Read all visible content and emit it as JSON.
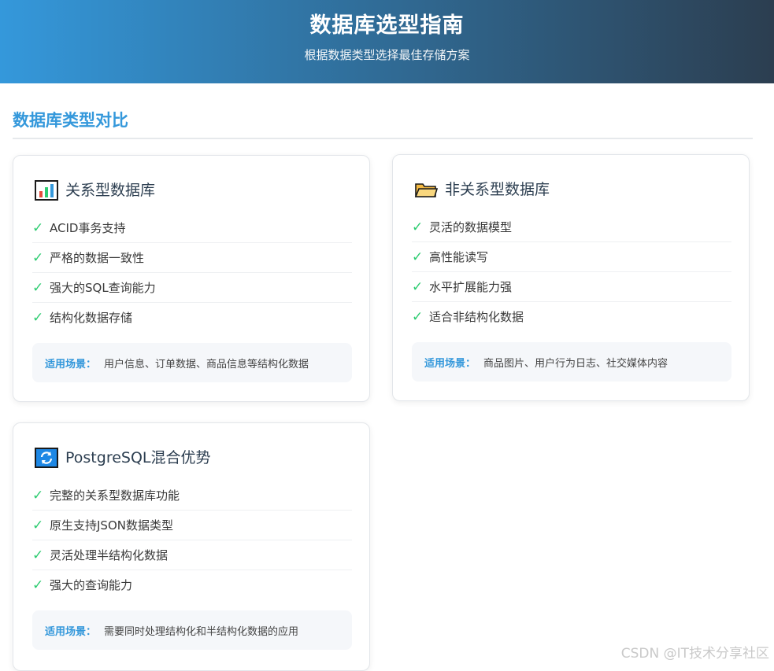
{
  "header": {
    "title": "数据库选型指南",
    "subtitle": "根据数据类型选择最佳存储方案"
  },
  "section": {
    "title": "数据库类型对比"
  },
  "cards": [
    {
      "icon": "bar-chart-icon",
      "title": "关系型数据库",
      "features": [
        "ACID事务支持",
        "严格的数据一致性",
        "强大的SQL查询能力",
        "结构化数据存储"
      ],
      "scenario_label": "适用场景：",
      "scenario_text": "用户信息、订单数据、商品信息等结构化数据"
    },
    {
      "icon": "folder-icon",
      "title": "非关系型数据库",
      "features": [
        "灵活的数据模型",
        "高性能读写",
        "水平扩展能力强",
        "适合非结构化数据"
      ],
      "scenario_label": "适用场景：",
      "scenario_text": "商品图片、用户行为日志、社交媒体内容"
    },
    {
      "icon": "refresh-icon",
      "title": "PostgreSQL混合优势",
      "features": [
        "完整的关系型数据库功能",
        "原生支持JSON数据类型",
        "灵活处理半结构化数据",
        "强大的查询能力"
      ],
      "scenario_label": "适用场景：",
      "scenario_text": "需要同时处理结构化和半结构化数据的应用"
    }
  ],
  "check_mark": "✓",
  "colors": {
    "accent": "#3498db",
    "header_gradient_end": "#2c3e50",
    "check": "#2ecc71"
  },
  "watermark": "CSDN @IT技术分享社区"
}
